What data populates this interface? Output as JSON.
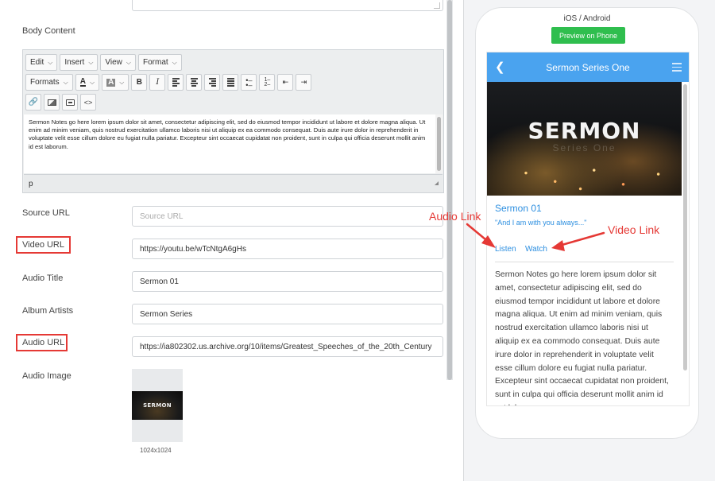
{
  "editor": {
    "body_content_label": "Body Content",
    "toolbar_row1": [
      "Edit",
      "Insert",
      "View",
      "Format"
    ],
    "formats_label": "Formats",
    "body_text": "Sermon Notes go here lorem ipsum dolor sit amet, consectetur adipiscing elit, sed do eiusmod tempor incididunt ut labore et dolore magna aliqua. Ut enim ad minim veniam, quis nostrud exercitation ullamco laboris nisi ut aliquip ex ea commodo consequat. Duis aute irure dolor in reprehenderit in voluptate velit esse cillum dolore eu fugiat nulla pariatur. Excepteur sint occaecat cupidatat non proident, sunt in culpa qui officia deserunt mollit anim id est laborum.",
    "status_path": "p"
  },
  "form": {
    "source_url": {
      "label": "Source URL",
      "placeholder": "Source URL",
      "value": ""
    },
    "video_url": {
      "label": "Video URL",
      "value": "https://youtu.be/wTcNtgA6gHs"
    },
    "audio_title": {
      "label": "Audio Title",
      "value": "Sermon 01"
    },
    "album_artists": {
      "label": "Album Artists",
      "value": "Sermon Series"
    },
    "audio_url": {
      "label": "Audio URL",
      "value": "https://ia802302.us.archive.org/10/items/Greatest_Speeches_of_the_20th_Century"
    },
    "audio_image": {
      "label": "Audio Image",
      "thumb_text": "SERMON",
      "dimensions": "1024x1024"
    }
  },
  "preview": {
    "platform": "iOS / Android",
    "preview_button": "Preview on Phone",
    "app_title": "Sermon Series One",
    "hero_word": "SERMON",
    "hero_sub": "Series One",
    "sermon_title": "Sermon 01",
    "sermon_quote": "\"And I am with you always...\"",
    "listen": "Listen",
    "watch": "Watch",
    "body": "Sermon Notes go here lorem ipsum dolor sit amet, consectetur adipiscing elit, sed do eiusmod tempor incididunt ut labore et dolore magna aliqua. Ut enim ad minim veniam, quis nostrud exercitation ullamco laboris nisi ut aliquip ex ea commodo consequat. Duis aute irure dolor in reprehenderit in voluptate velit esse cillum dolore eu fugiat nulla pariatur. Excepteur sint occaecat cupidatat non proident, sunt in culpa qui officia deserunt mollit anim id est laborum."
  },
  "annotations": {
    "audio_link": "Audio Link",
    "video_link": "Video Link"
  },
  "colors": {
    "accent_blue": "#4aa3ef",
    "link_blue": "#2d8fe0",
    "preview_green": "#2fbe4e",
    "annotation_red": "#e53935"
  }
}
